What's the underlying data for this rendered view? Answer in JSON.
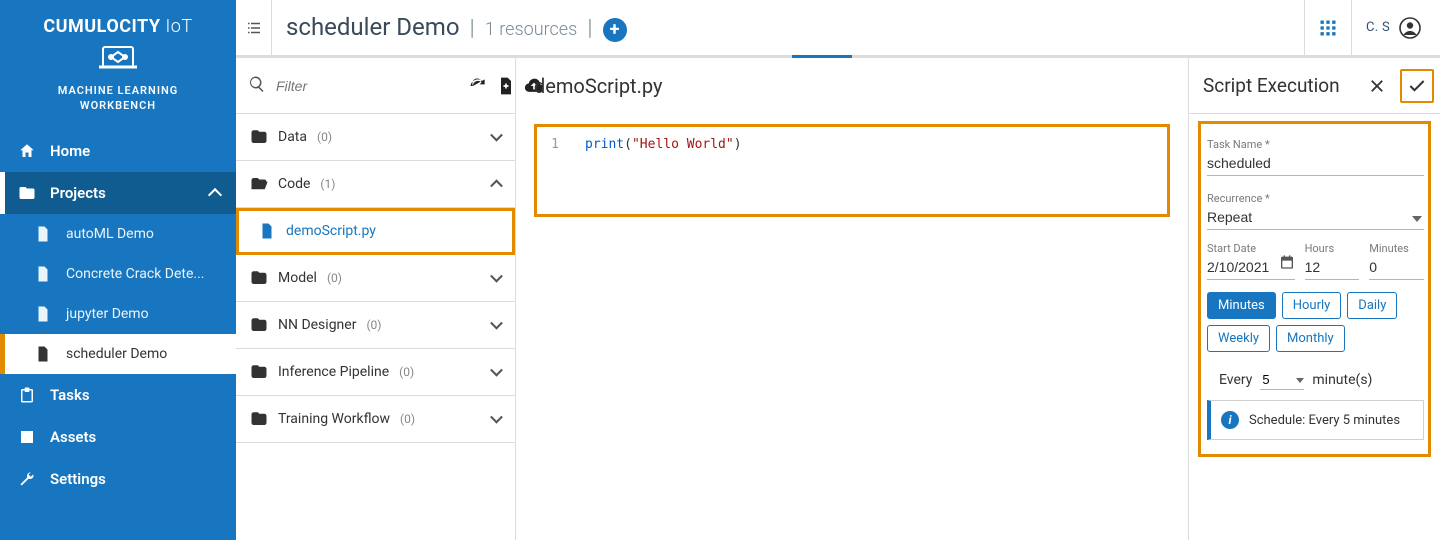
{
  "brand": {
    "line1_a": "CUMULOCITY",
    "line1_b": "IoT",
    "sub1": "MACHINE LEARNING",
    "sub2": "WORKBENCH"
  },
  "nav": {
    "home": "Home",
    "projects": "Projects",
    "projects_items": [
      {
        "label": "autoML Demo"
      },
      {
        "label": "Concrete Crack Dete..."
      },
      {
        "label": "jupyter Demo"
      },
      {
        "label": "scheduler Demo"
      }
    ],
    "tasks": "Tasks",
    "assets": "Assets",
    "settings": "Settings"
  },
  "topbar": {
    "title": "scheduler Demo",
    "sub": "1 resources",
    "user": "C. S"
  },
  "files": {
    "filter_placeholder": "Filter",
    "folders": [
      {
        "name": "Data",
        "count": "(0)",
        "expanded": false
      },
      {
        "name": "Code",
        "count": "(1)",
        "expanded": true
      },
      {
        "name": "Model",
        "count": "(0)",
        "expanded": false
      },
      {
        "name": "NN Designer",
        "count": "(0)",
        "expanded": false
      },
      {
        "name": "Inference Pipeline",
        "count": "(0)",
        "expanded": false
      },
      {
        "name": "Training Workflow",
        "count": "(0)",
        "expanded": false
      }
    ],
    "active_file": "demoScript.py"
  },
  "code": {
    "filename": "demoScript.py",
    "line_no": "1",
    "tok_fn": "print",
    "tok_paren_l": "(",
    "tok_str": "\"Hello World\"",
    "tok_paren_r": ")"
  },
  "exec": {
    "title": "Script Execution",
    "task_label": "Task Name",
    "task_value": "scheduled",
    "rec_label": "Recurrence",
    "rec_value": "Repeat",
    "date_label": "Start Date",
    "date_value": "2/10/2021",
    "hours_label": "Hours",
    "hours_value": "12",
    "minutes_label": "Minutes",
    "minutes_value": "0",
    "chips": [
      "Minutes",
      "Hourly",
      "Daily",
      "Weekly",
      "Monthly"
    ],
    "chip_active_index": 0,
    "every_label": "Every",
    "every_value": "5",
    "every_unit": "minute(s)",
    "info": "Schedule: Every 5 minutes"
  }
}
